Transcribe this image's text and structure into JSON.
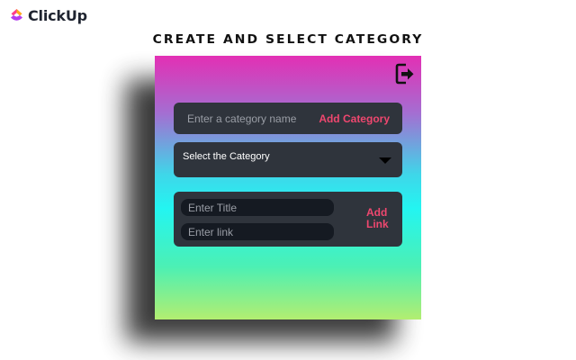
{
  "brand": {
    "name": "ClickUp"
  },
  "heading": "CREATE AND SELECT CATEGORY",
  "category": {
    "input_placeholder": "Enter a category name",
    "add_label": "Add Category"
  },
  "select": {
    "selected": "Select the Category"
  },
  "link_form": {
    "title_placeholder": "Enter Title",
    "link_placeholder": "Enter link",
    "add_line1": "Add",
    "add_line2": "Link"
  },
  "icons": {
    "logout": "logout-icon",
    "dropdown": "caret-down-icon",
    "logo": "clickup-logo-icon"
  },
  "colors": {
    "accent": "#ef476f",
    "card": "#2f343c",
    "input_bg": "#151a22"
  }
}
